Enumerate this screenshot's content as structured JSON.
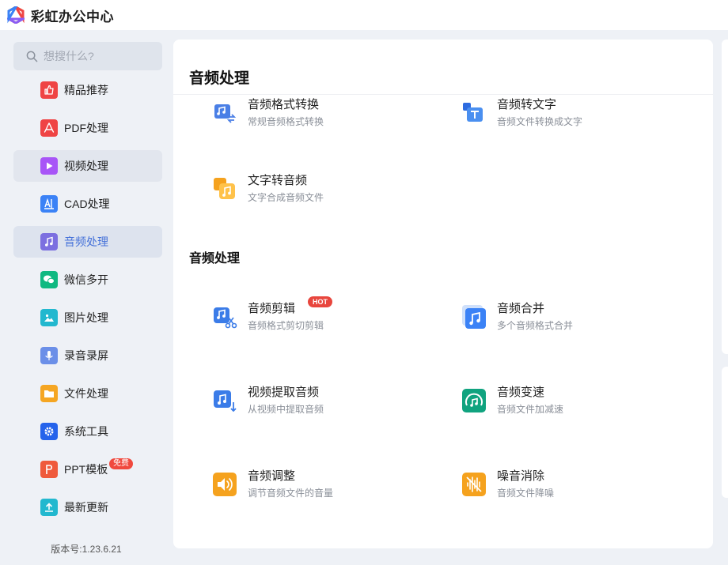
{
  "app": {
    "title": "彩虹办公中心"
  },
  "search": {
    "placeholder": "想搜什么?"
  },
  "sidebar": {
    "items": [
      {
        "label": "精品推荐",
        "icon": "thumbs-up-icon",
        "color": "#ef4444"
      },
      {
        "label": "PDF处理",
        "icon": "pdf-icon",
        "color": "#ef4444"
      },
      {
        "label": "视频处理",
        "icon": "play-icon",
        "color": "#a855f7"
      },
      {
        "label": "CAD处理",
        "icon": "cad-icon",
        "color": "#3b82f6"
      },
      {
        "label": "音频处理",
        "icon": "music-note-icon",
        "color": "#7c6fe0"
      },
      {
        "label": "微信多开",
        "icon": "wechat-icon",
        "color": "#10b981"
      },
      {
        "label": "图片处理",
        "icon": "image-icon",
        "color": "#22b8cf"
      },
      {
        "label": "录音录屏",
        "icon": "microphone-icon",
        "color": "#6b8fe8"
      },
      {
        "label": "文件处理",
        "icon": "folder-icon",
        "color": "#f5a623"
      },
      {
        "label": "系统工具",
        "icon": "gear-icon",
        "color": "#2563eb"
      },
      {
        "label": "PPT模板",
        "icon": "ppt-icon",
        "color": "#ef5a3c",
        "badge": "免费"
      },
      {
        "label": "最新更新",
        "icon": "upload-icon",
        "color": "#22b8cf"
      }
    ],
    "active_index": 4,
    "hover_index": 2
  },
  "version": "版本号:1.23.6.21",
  "main": {
    "header": "音频处理",
    "top_section": {
      "tools": [
        {
          "name": "音频格式转换",
          "desc": "常规音频格式转换",
          "icon": "audio-convert-icon"
        },
        {
          "name": "音频转文字",
          "desc": "音频文件转换成文字",
          "icon": "audio-to-text-icon"
        },
        {
          "name": "文字转音频",
          "desc": "文字合成音频文件",
          "icon": "text-to-audio-icon"
        }
      ]
    },
    "section2": {
      "title": "音频处理",
      "tools": [
        {
          "name": "音频剪辑",
          "desc": "音频格式剪切剪辑",
          "icon": "audio-cut-icon",
          "badge": "HOT"
        },
        {
          "name": "音频合并",
          "desc": "多个音频格式合并",
          "icon": "audio-merge-icon"
        },
        {
          "name": "视频提取音频",
          "desc": "从视频中提取音频",
          "icon": "video-extract-audio-icon"
        },
        {
          "name": "音频变速",
          "desc": "音频文件加减速",
          "icon": "audio-speed-icon"
        },
        {
          "name": "音频调整",
          "desc": "调节音频文件的音量",
          "icon": "volume-icon"
        },
        {
          "name": "噪音消除",
          "desc": "音频文件降噪",
          "icon": "noise-reduce-icon"
        }
      ]
    }
  }
}
